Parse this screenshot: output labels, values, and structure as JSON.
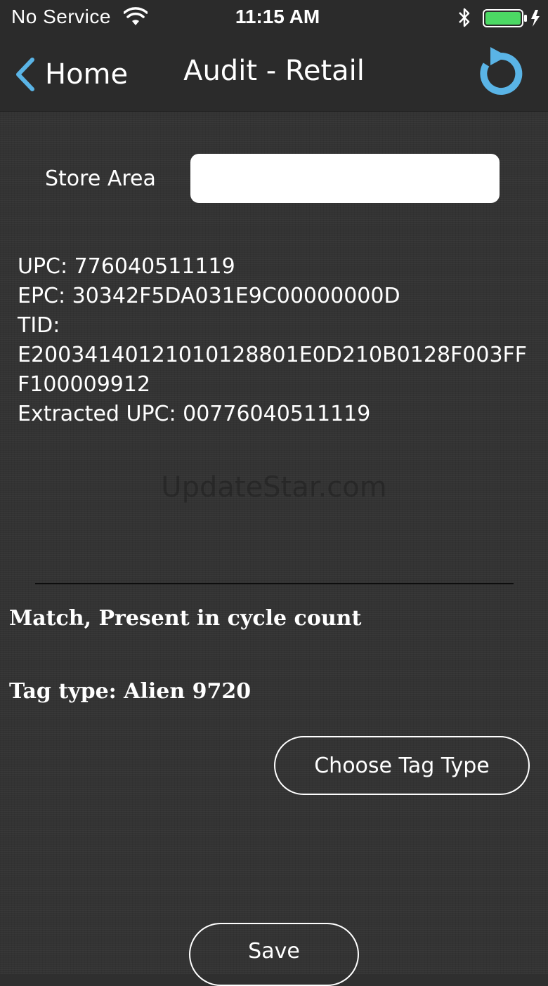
{
  "status_bar": {
    "carrier": "No Service",
    "time": "11:15 AM",
    "icons": [
      "wifi-icon",
      "bluetooth-icon",
      "battery-icon",
      "charging-bolt-icon"
    ],
    "battery_color": "#4cd964"
  },
  "nav": {
    "back_label": "Home",
    "title": "Audit - Retail",
    "back_icon": "chevron-left-icon",
    "refresh_icon": "refresh-icon",
    "accent_color": "#5ab4e6"
  },
  "form": {
    "store_area_label": "Store Area",
    "store_area_value": "",
    "store_area_placeholder": ""
  },
  "tag_info": {
    "upc": "UPC: 776040511119",
    "epc": "EPC: 30342F5DA031E9C00000000D",
    "tid_label": "TID:",
    "tid_value": "E2003414012101012880 1E0D210B0128F003FFF100009912",
    "extracted_upc": "Extracted UPC: 00776040511119"
  },
  "watermark": "UpdateStar.com",
  "result": {
    "match_status": "Match, Present in cycle count",
    "tag_type": "Tag type: Alien 9720"
  },
  "buttons": {
    "choose_tag_type": "Choose Tag Type",
    "save": "Save"
  }
}
